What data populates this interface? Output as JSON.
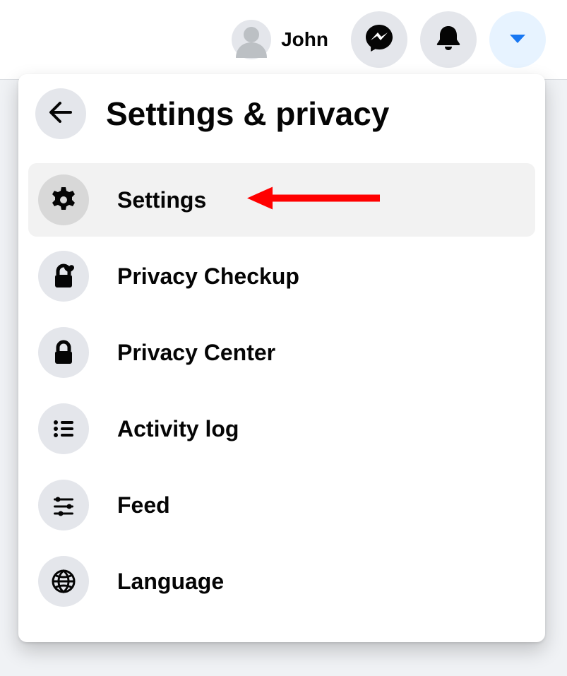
{
  "topbar": {
    "profile_name": "John"
  },
  "panel": {
    "title": "Settings & privacy",
    "items": [
      {
        "label": "Settings",
        "icon": "gear",
        "selected": true,
        "annotation_arrow": true
      },
      {
        "label": "Privacy Checkup",
        "icon": "lock-heart",
        "selected": false
      },
      {
        "label": "Privacy Center",
        "icon": "lock",
        "selected": false
      },
      {
        "label": "Activity log",
        "icon": "list",
        "selected": false
      },
      {
        "label": "Feed",
        "icon": "sliders",
        "selected": false
      },
      {
        "label": "Language",
        "icon": "globe",
        "selected": false
      }
    ]
  },
  "annotation": {
    "arrow_color": "#ff0000"
  }
}
